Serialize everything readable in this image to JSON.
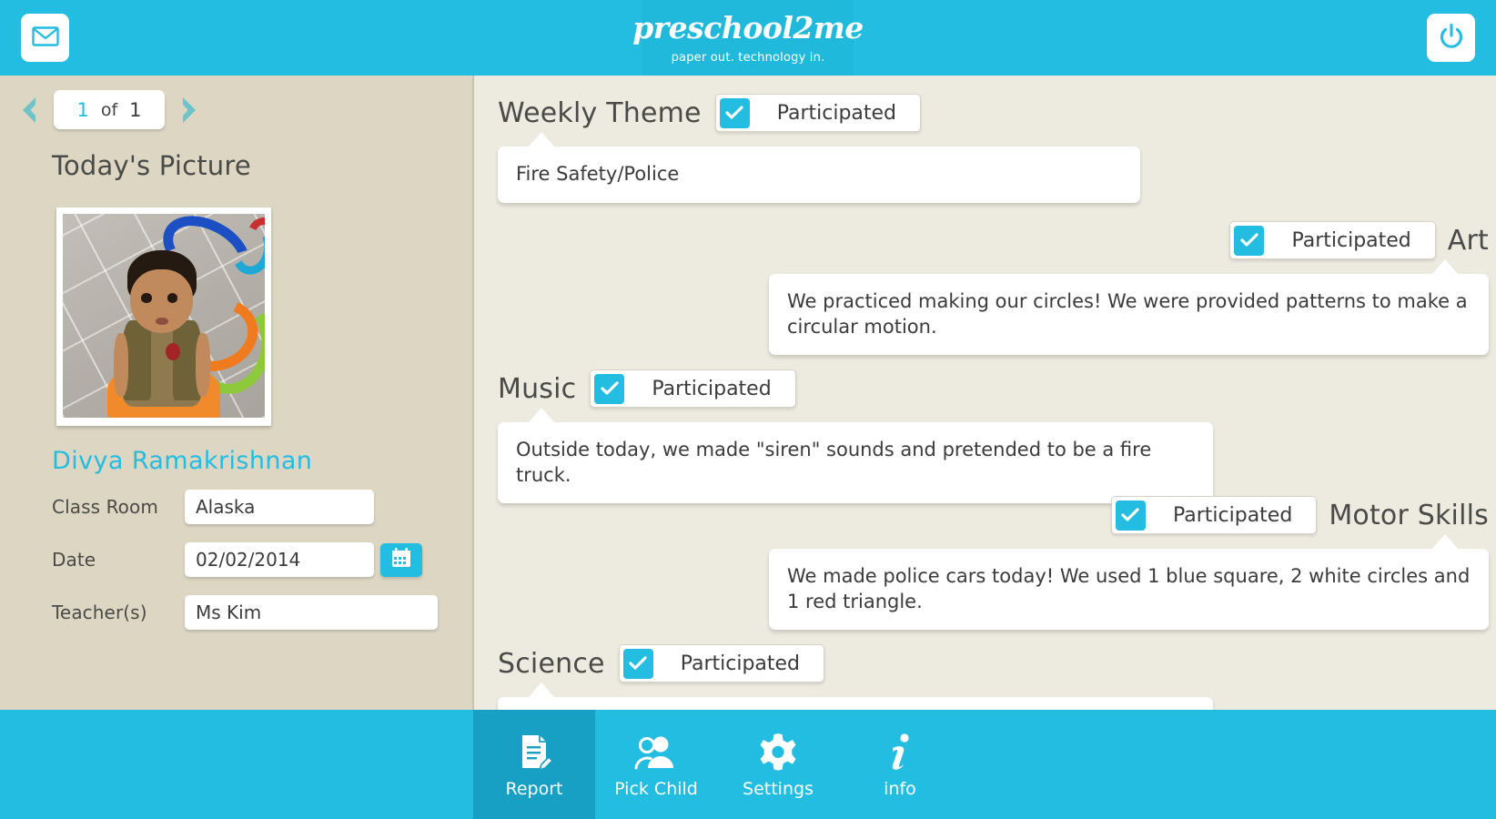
{
  "header": {
    "logo_main": "preschool2me",
    "logo_tagline": "paper out. technology in.",
    "mail_button": "mail-icon",
    "power_button": "power-icon",
    "accent_color": "#22BDE0"
  },
  "sidebar": {
    "pager": {
      "current": "1",
      "separator": "of",
      "total": "1",
      "prev": "previous-child",
      "next": "next-child"
    },
    "picture_title": "Today's Picture",
    "child_name": "Divya  Ramakrishnan",
    "fields": [
      {
        "label": "Class Room",
        "value": "Alaska"
      },
      {
        "label": "Date",
        "value": "02/02/2014"
      },
      {
        "label": "Teacher(s)",
        "value": "Ms Kim"
      }
    ],
    "calendar_button": "calendar-icon",
    "bg_color": "#DCD6C3"
  },
  "main": {
    "bg_color": "#EDEBE0",
    "checkbox_label": "Participated",
    "sections": [
      {
        "title": "Weekly Theme",
        "participated": true,
        "note": "Fire Safety/Police",
        "align": "left"
      },
      {
        "title": "Art",
        "participated": true,
        "note": "We practiced making our circles! We were provided patterns to make a circular motion.",
        "align": "right"
      },
      {
        "title": "Music",
        "participated": true,
        "note": "Outside today, we made \"siren\" sounds and pretended to be a fire truck.",
        "align": "left"
      },
      {
        "title": "Motor Skills",
        "participated": true,
        "note": "We made police cars today! We used 1 blue square, 2 white circles and 1 red triangle.",
        "align": "right"
      },
      {
        "title": "Science",
        "participated": true,
        "note": "",
        "align": "left"
      }
    ]
  },
  "bottom_nav": {
    "items": [
      {
        "label": "Report",
        "icon": "report-document-pencil-icon",
        "active": true
      },
      {
        "label": "Pick Child",
        "icon": "people-icon",
        "active": false
      },
      {
        "label": "Settings",
        "icon": "gear-icon",
        "active": false
      },
      {
        "label": "info",
        "icon": "info-italic-i-icon",
        "active": false
      }
    ],
    "active_bg": "#18A0C4"
  }
}
